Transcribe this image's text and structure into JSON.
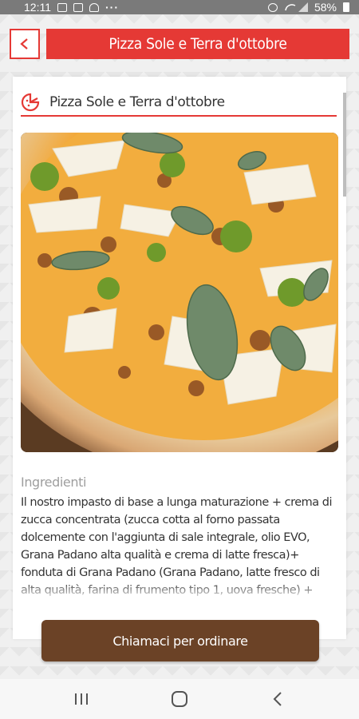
{
  "status_bar": {
    "time": "12:11",
    "dots": "···",
    "battery": "58%"
  },
  "header": {
    "title": "Pizza Sole e Terra d'ottobre"
  },
  "card": {
    "title": "Pizza Sole e Terra d'ottobre",
    "ingredients_label": "Ingredienti",
    "ingredients_text": "Il nostro impasto di base a lunga maturazione + crema di zucca concentrata (zucca cotta al forno passata dolcemente con l'aggiunta di sale integrale, olio EVO, Grana Padano alta qualità e crema di latte fresca)+ fonduta di Grana Padano (Grana Padano, latte fresco di alta qualità, farina di frumento tipo 1, uova fresche) + salsiccia al forno+ broccoli croccanti cotti in forno +scaglie di"
  },
  "call_button": {
    "label": "Chiamaci per ordinare"
  },
  "colors": {
    "accent": "#e53935",
    "button": "#6b4226"
  },
  "icons": [
    "back-arrow-icon",
    "pizza-slice-icon",
    "recent-apps-icon",
    "home-icon",
    "back-nav-icon"
  ]
}
